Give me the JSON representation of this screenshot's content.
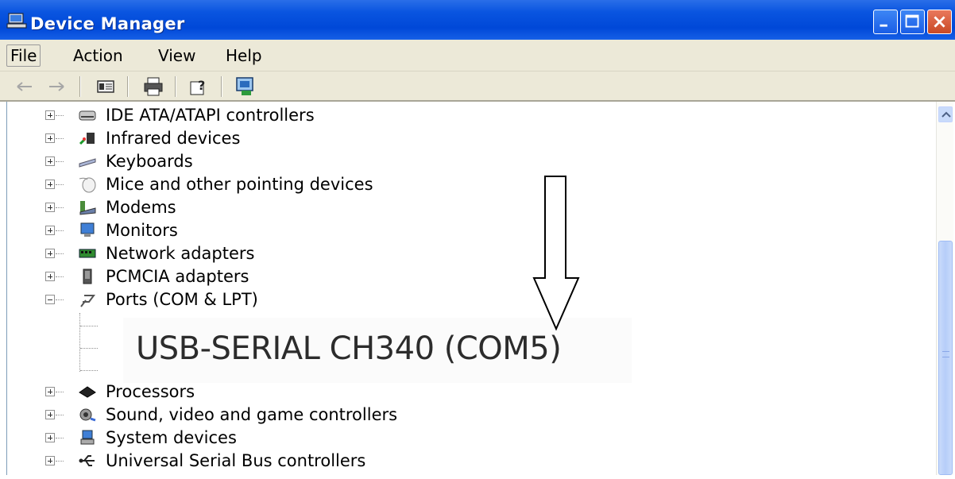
{
  "window": {
    "title": "Device Manager",
    "icon": "computer-icon"
  },
  "menu": {
    "items": [
      "File",
      "Action",
      "View",
      "Help"
    ]
  },
  "toolbar": {
    "buttons": [
      "back-arrow-icon",
      "forward-arrow-icon",
      "properties-icon",
      "print-icon",
      "help-icon",
      "update-driver-icon"
    ]
  },
  "tree": {
    "items": [
      {
        "label": "IDE ATA/ATAPI controllers",
        "icon": "disk-controller-icon",
        "expanded": false
      },
      {
        "label": "Infrared devices",
        "icon": "infrared-icon",
        "expanded": false
      },
      {
        "label": "Keyboards",
        "icon": "keyboard-icon",
        "expanded": false
      },
      {
        "label": "Mice and other pointing devices",
        "icon": "mouse-icon",
        "expanded": false
      },
      {
        "label": "Modems",
        "icon": "modem-icon",
        "expanded": false
      },
      {
        "label": "Monitors",
        "icon": "monitor-icon",
        "expanded": false
      },
      {
        "label": "Network adapters",
        "icon": "network-adapter-icon",
        "expanded": false
      },
      {
        "label": "PCMCIA adapters",
        "icon": "pcmcia-icon",
        "expanded": false
      },
      {
        "label": "Ports (COM & LPT)",
        "icon": "port-icon",
        "expanded": true
      },
      {
        "label": "Processors",
        "icon": "processor-icon",
        "expanded": false
      },
      {
        "label": "Sound, video and game controllers",
        "icon": "sound-icon",
        "expanded": false
      },
      {
        "label": "System devices",
        "icon": "system-device-icon",
        "expanded": false
      },
      {
        "label": "Universal Serial Bus controllers",
        "icon": "usb-icon",
        "expanded": false
      }
    ]
  },
  "callout": {
    "text": "USB-SERIAL CH340 (COM5)"
  },
  "colors": {
    "titlebar": "#0a55e0",
    "chrome": "#ece9d8",
    "close_button": "#d65a34"
  }
}
